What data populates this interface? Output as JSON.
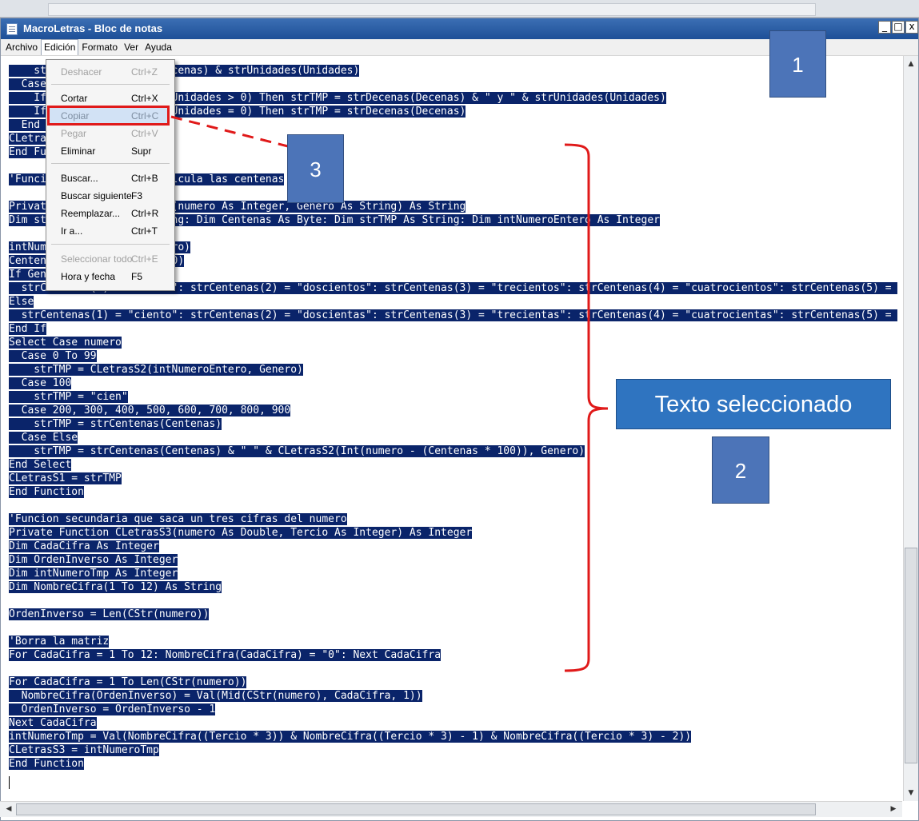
{
  "window": {
    "title": "MacroLetras - Bloc de notas",
    "controls": {
      "minimize": "_",
      "maximize": "□",
      "close": "x"
    }
  },
  "menubar": [
    "Archivo",
    "Edición",
    "Formato",
    "Ver",
    "Ayuda"
  ],
  "edit_menu": {
    "items": [
      {
        "label": "Deshacer",
        "shortcut": "Ctrl+Z",
        "enabled": false
      },
      {
        "label": "Cortar",
        "shortcut": "Ctrl+X",
        "enabled": true
      },
      {
        "label": "Copiar",
        "shortcut": "Ctrl+C",
        "enabled": true
      },
      {
        "label": "Pegar",
        "shortcut": "Ctrl+V",
        "enabled": false
      },
      {
        "label": "Eliminar",
        "shortcut": "Supr",
        "enabled": true
      },
      {
        "label": "Buscar...",
        "shortcut": "Ctrl+B",
        "enabled": true
      },
      {
        "label": "Buscar siguiente",
        "shortcut": "F3",
        "enabled": true
      },
      {
        "label": "Reemplazar...",
        "shortcut": "Ctrl+R",
        "enabled": true
      },
      {
        "label": "Ir a...",
        "shortcut": "Ctrl+T",
        "enabled": true
      },
      {
        "label": "Seleccionar todo",
        "shortcut": "Ctrl+E",
        "enabled": false
      },
      {
        "label": "Hora y fecha",
        "shortcut": "F5",
        "enabled": true
      }
    ]
  },
  "code_lines": [
    "    strTMP = strDecenas(Decenas) & strUnidades(Unidades)",
    "  Case 2",
    "    If (Decenas > 1) And (Unidades > 0) Then strTMP = strDecenas(Decenas) & \" y \" & strUnidades(Unidades)",
    "    If (Decenas > 1) And (Unidades = 0) Then strTMP = strDecenas(Decenas)",
    "  End Select",
    "CLetrasS2 = strTMP",
    "End Function",
    "",
    "'Funcion secundaria que calcula las centenas",
    "",
    "Private Function CLetrasS1(numero As Integer, Genero As String) As String",
    "Dim strCentenas(9) As String: Dim Centenas As Byte: Dim strTMP As String: Dim intNumeroEntero As Integer",
    "",
    "intNumeroEntero = Int(numero)",
    "Centenas = Int(numero / 100)",
    "If Genero = \"M\" Then",
    "  strCentenas(1) = \"ciento\": strCentenas(2) = \"doscientos\": strCentenas(3) = \"trecientos\": strCentenas(4) = \"cuatrocientos\": strCentenas(5) = ",
    "Else",
    "  strCentenas(1) = \"ciento\": strCentenas(2) = \"doscientas\": strCentenas(3) = \"trecientas\": strCentenas(4) = \"cuatrocientas\": strCentenas(5) = ",
    "End If",
    "Select Case numero",
    "  Case 0 To 99",
    "    strTMP = CLetrasS2(intNumeroEntero, Genero)",
    "  Case 100",
    "    strTMP = \"cien\"",
    "  Case 200, 300, 400, 500, 600, 700, 800, 900",
    "    strTMP = strCentenas(Centenas)",
    "  Case Else",
    "    strTMP = strCentenas(Centenas) & \" \" & CLetrasS2(Int(numero - (Centenas * 100)), Genero)",
    "End Select",
    "CLetrasS1 = strTMP",
    "End Function",
    "",
    "'Funcion secundaria que saca un tres cifras del numero",
    "Private Function CLetrasS3(numero As Double, Tercio As Integer) As Integer",
    "Dim CadaCifra As Integer",
    "Dim OrdenInverso As Integer",
    "Dim intNumeroTmp As Integer",
    "Dim NombreCifra(1 To 12) As String",
    "",
    "OrdenInverso = Len(CStr(numero))",
    "",
    "'Borra la matriz",
    "For CadaCifra = 1 To 12: NombreCifra(CadaCifra) = \"0\": Next CadaCifra",
    "",
    "For CadaCifra = 1 To Len(CStr(numero))",
    "  NombreCifra(OrdenInverso) = Val(Mid(CStr(numero), CadaCifra, 1))",
    "  OrdenInverso = OrdenInverso - 1",
    "Next CadaCifra",
    "intNumeroTmp = Val(NombreCifra((Tercio * 3)) & NombreCifra((Tercio * 3) - 1) & NombreCifra((Tercio * 3) - 2))",
    "CLetrasS3 = intNumeroTmp",
    "End Function"
  ],
  "annotations": {
    "callout_1": "1",
    "callout_2": "2",
    "callout_3": "3",
    "selection_label": "Texto seleccionado",
    "accent_red": "#e01a1a",
    "callout_blue": "#4c74b8",
    "selection_blue": "#0a246a"
  }
}
